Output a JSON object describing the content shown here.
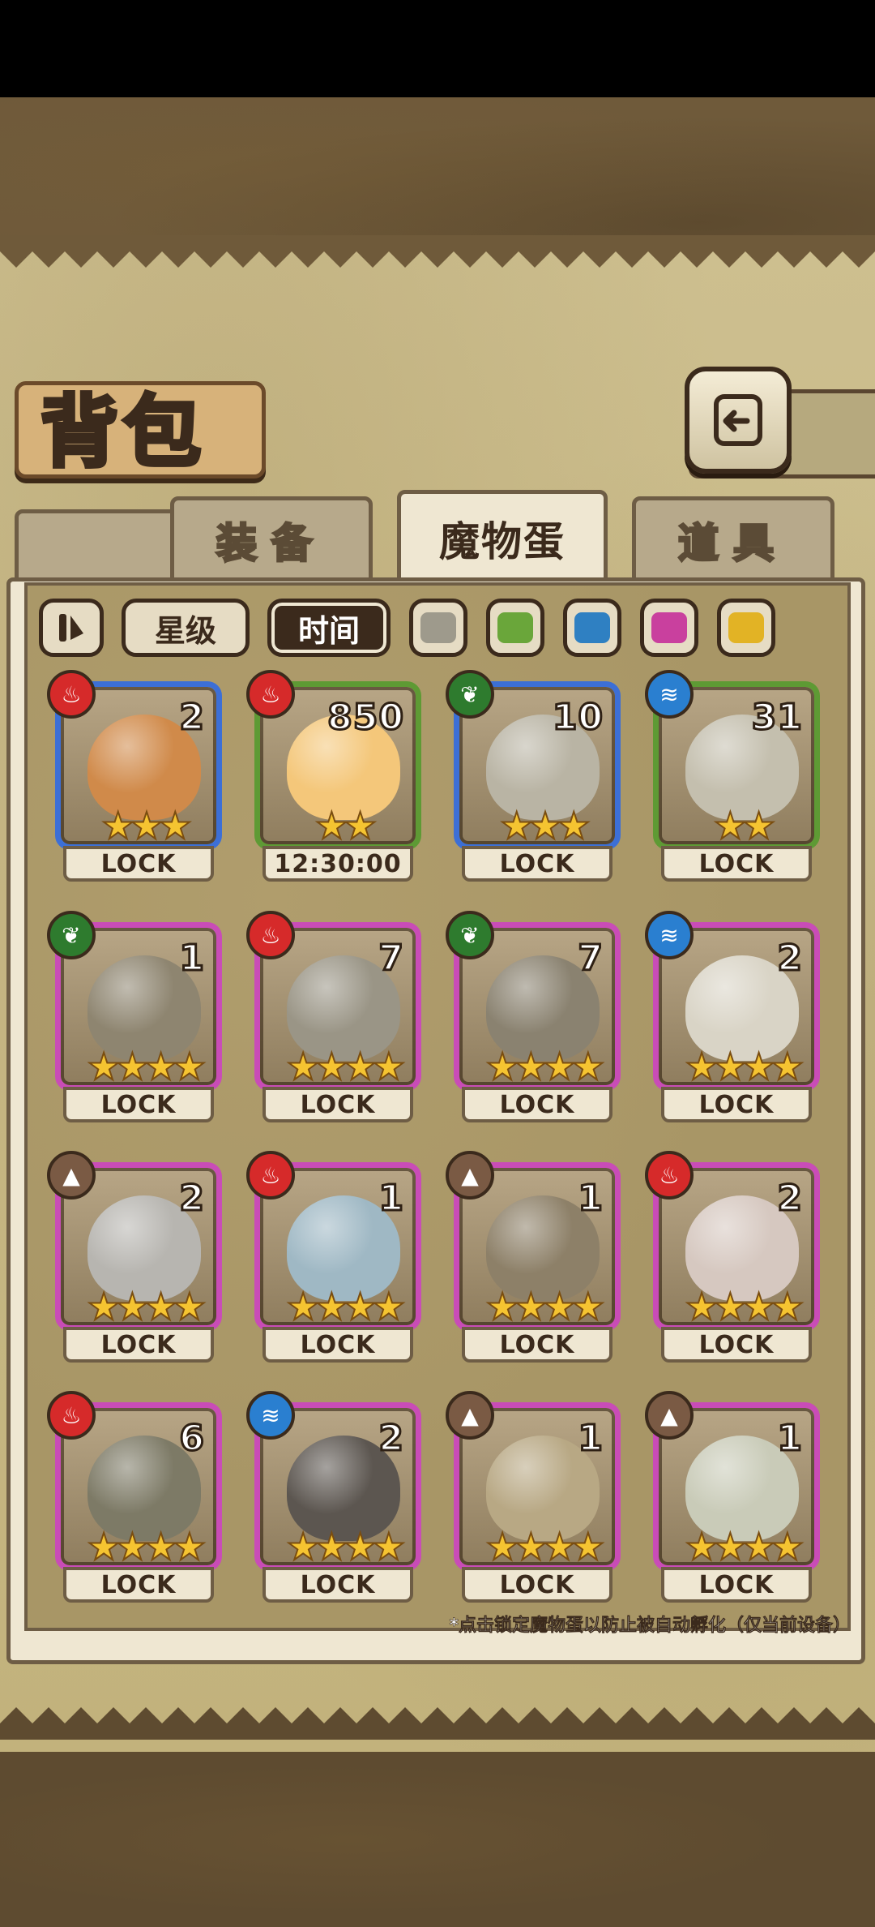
{
  "header": {
    "title": "背包"
  },
  "tabs": [
    {
      "label": "装备",
      "active": false
    },
    {
      "label": "魔物蛋",
      "active": true
    },
    {
      "label": "道具",
      "active": false
    }
  ],
  "filters": {
    "sort_icon": "sort-toggle-icon",
    "star_label": "星级",
    "time_label": "时间",
    "time_active": true,
    "color_swatches": [
      "#9e9a8c",
      "#6aa63a",
      "#2f80c2",
      "#c9409e",
      "#e2b325"
    ]
  },
  "cards": [
    {
      "element": "fire",
      "count": "2",
      "stars": 3,
      "rarity": "blue",
      "status": "LOCK"
    },
    {
      "element": "fire",
      "count": "850",
      "stars": 2,
      "rarity": "green",
      "status": "12:30:00"
    },
    {
      "element": "leaf",
      "count": "10",
      "stars": 3,
      "rarity": "blue",
      "status": "LOCK"
    },
    {
      "element": "water",
      "count": "31",
      "stars": 2,
      "rarity": "green",
      "status": "LOCK"
    },
    {
      "element": "leaf",
      "count": "1",
      "stars": 4,
      "rarity": "pink",
      "status": "LOCK"
    },
    {
      "element": "fire",
      "count": "7",
      "stars": 4,
      "rarity": "pink",
      "status": "LOCK"
    },
    {
      "element": "leaf",
      "count": "7",
      "stars": 4,
      "rarity": "pink",
      "status": "LOCK"
    },
    {
      "element": "water",
      "count": "2",
      "stars": 4,
      "rarity": "pink",
      "status": "LOCK"
    },
    {
      "element": "earth",
      "count": "2",
      "stars": 4,
      "rarity": "pink",
      "status": "LOCK"
    },
    {
      "element": "fire",
      "count": "1",
      "stars": 4,
      "rarity": "pink",
      "status": "LOCK"
    },
    {
      "element": "earth",
      "count": "1",
      "stars": 4,
      "rarity": "pink",
      "status": "LOCK"
    },
    {
      "element": "fire",
      "count": "2",
      "stars": 4,
      "rarity": "pink",
      "status": "LOCK"
    },
    {
      "element": "fire",
      "count": "6",
      "stars": 4,
      "rarity": "pink",
      "status": "LOCK"
    },
    {
      "element": "water",
      "count": "2",
      "stars": 4,
      "rarity": "pink",
      "status": "LOCK"
    },
    {
      "element": "earth",
      "count": "1",
      "stars": 4,
      "rarity": "pink",
      "status": "LOCK"
    },
    {
      "element": "earth",
      "count": "1",
      "stars": 4,
      "rarity": "pink",
      "status": "LOCK"
    }
  ],
  "colors": {
    "rarity_blue": "#3c6fd6",
    "rarity_green": "#5e9a34",
    "rarity_pink": "#c94cb7",
    "element_fire": "#d62a2a",
    "element_leaf": "#2e7b2e",
    "element_water": "#2a7fd0",
    "element_earth": "#7a5a44"
  },
  "footer": {
    "hint": "*点击锁定魔物蛋以防止被自动孵化（仅当前设备）"
  }
}
